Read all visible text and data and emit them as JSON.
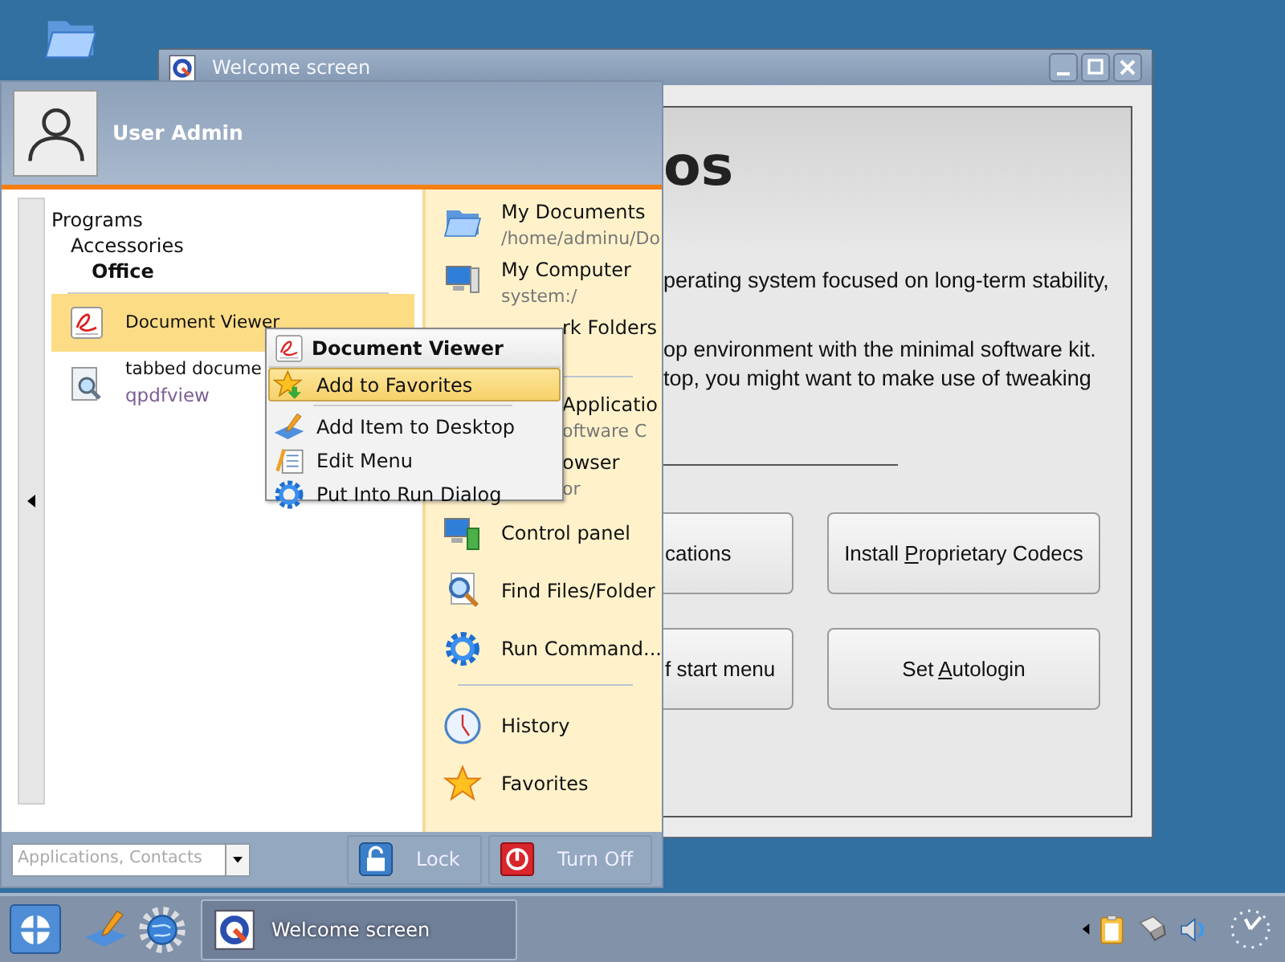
{
  "welcome_window": {
    "title": "Welcome screen",
    "heading": "os",
    "lines": [
      "perating system focused on long-term stability,",
      "op environment with the minimal software kit.",
      "top, you might want to make use of tweaking"
    ],
    "buttons": [
      {
        "parts": [
          {
            "text": "cations",
            "mnemonic": false
          }
        ]
      },
      {
        "parts": [
          {
            "text": "Install ",
            "mnemonic": false
          },
          {
            "text": "P",
            "mnemonic": true
          },
          {
            "text": "roprietary Codecs",
            "mnemonic": false
          }
        ]
      },
      {
        "parts": [
          {
            "text": "f start menu",
            "mnemonic": false
          }
        ]
      },
      {
        "parts": [
          {
            "text": "Set ",
            "mnemonic": false
          },
          {
            "text": "A",
            "mnemonic": true
          },
          {
            "text": "utologin",
            "mnemonic": false
          }
        ]
      }
    ]
  },
  "start_menu": {
    "user": "User Admin",
    "breadcrumb": [
      {
        "label": "Programs",
        "selected": false,
        "children": [
          {
            "label": "Accessories",
            "selected": false,
            "children": [
              {
                "label": "Office",
                "selected": true
              }
            ]
          }
        ]
      }
    ],
    "apps": [
      {
        "title": "Document Viewer",
        "selected": true
      },
      {
        "title": "tabbed docume",
        "subtitle": "qpdfview",
        "selected": false
      }
    ],
    "places": [
      {
        "kind": "place",
        "title": "My Documents",
        "subtitle": "/home/adminu/Do"
      },
      {
        "kind": "place",
        "title": "My Computer",
        "subtitle": "system:/"
      },
      {
        "kind": "covered",
        "title": "rk Folders"
      },
      {
        "kind": "separator"
      },
      {
        "kind": "covered",
        "title": "Applicatio",
        "subtitle": "oftware C"
      },
      {
        "kind": "covered",
        "title": "owser",
        "subtitle": "or"
      },
      {
        "kind": "action",
        "title": "Control panel"
      },
      {
        "kind": "action",
        "title": "Find Files/Folder"
      },
      {
        "kind": "action",
        "title": "Run Command..."
      },
      {
        "kind": "separator"
      },
      {
        "kind": "action",
        "title": "History"
      },
      {
        "kind": "action",
        "title": "Favorites"
      }
    ],
    "search": {
      "placeholder": "Applications, Contacts"
    },
    "buttons": [
      "Lock",
      "Turn Off"
    ]
  },
  "context_menu": {
    "title": "Document Viewer",
    "items": [
      {
        "kind": "item",
        "label": "Add to Favorites",
        "selected": true
      },
      {
        "kind": "separator"
      },
      {
        "kind": "item",
        "label": "Add Item to Desktop",
        "selected": false
      },
      {
        "kind": "item",
        "label": "Edit Menu",
        "selected": false
      },
      {
        "kind": "item",
        "label": "Put Into Run Dialog",
        "selected": false
      }
    ]
  },
  "taskbar": {
    "tasks": [
      {
        "label": "Welcome screen",
        "selected": true
      }
    ]
  }
}
